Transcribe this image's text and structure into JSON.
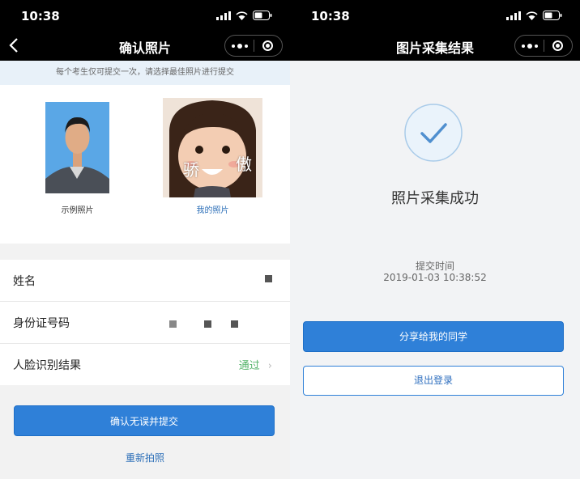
{
  "left": {
    "status": {
      "time": "10:38"
    },
    "nav": {
      "title": "确认照片"
    },
    "tip": "每个考生仅可提交一次，请选择最佳照片进行提交",
    "photos": {
      "sample_label": "示例照片",
      "mine_label": "我的照片",
      "watermark_left": "骄",
      "watermark_right": "傲"
    },
    "form": {
      "name_label": "姓名",
      "id_label": "身份证号码",
      "face_label": "人脸识别结果",
      "face_value": "通过"
    },
    "submit_label": "确认无误并提交",
    "retake_label": "重新拍照"
  },
  "right": {
    "status": {
      "time": "10:38"
    },
    "nav": {
      "title": "图片采集结果"
    },
    "success_title": "照片采集成功",
    "time_label": "提交时间",
    "time_value": "2019-01-03 10:38:52",
    "share_label": "分享给我的同学",
    "logout_label": "退出登录"
  },
  "colors": {
    "primary": "#2f80d8",
    "pass": "#54b36a",
    "link": "#2c6fb8"
  },
  "icons": [
    "back-icon",
    "more-icon",
    "target-icon",
    "check-icon",
    "chevron-right-icon",
    "signal-icon",
    "wifi-icon",
    "battery-icon"
  ]
}
